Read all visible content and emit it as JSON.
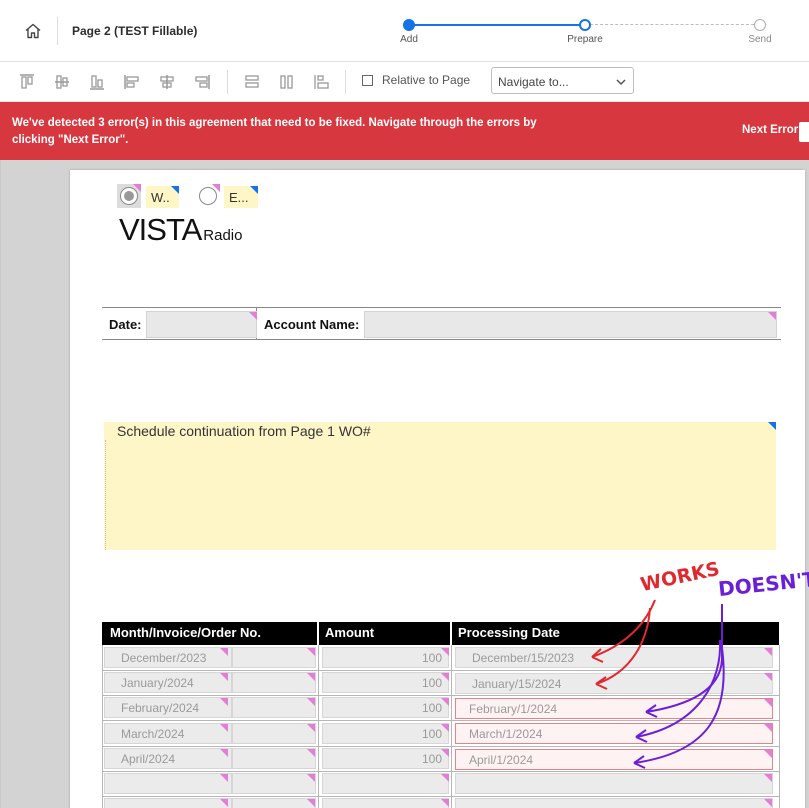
{
  "header": {
    "page_title": "Page 2 (TEST Fillable)",
    "steps": [
      {
        "label": "Add"
      },
      {
        "label": "Prepare"
      },
      {
        "label": "Send"
      }
    ]
  },
  "toolbar": {
    "relative_to_page_label": "Relative to Page",
    "relative_to_page_checked": false,
    "navigate_placeholder": "Navigate to..."
  },
  "error_banner": {
    "message": "We've detected 3 error(s) in this agreement that need to be fixed. Navigate through the errors by clicking \"Next Error\".",
    "next_error_label": "Next Error"
  },
  "document": {
    "radio_options": [
      {
        "label": "W..",
        "selected": true
      },
      {
        "label": "E...",
        "selected": false
      }
    ],
    "logo": {
      "main": "VISTA",
      "sub": "Radio"
    },
    "date_label": "Date:",
    "account_label": "Account Name:",
    "notes_text": "Schedule continuation from Page 1   WO#",
    "table": {
      "headers": [
        "Month/Invoice/Order No.",
        "Amount",
        "Processing Date"
      ],
      "rows": [
        {
          "month": "December/2023",
          "amount": "100",
          "date": "December/15/2023",
          "error": false
        },
        {
          "month": "January/2024",
          "amount": "100",
          "date": "January/15/2024",
          "error": false
        },
        {
          "month": "February/2024",
          "amount": "100",
          "date": "February/1/2024",
          "error": true
        },
        {
          "month": "March/2024",
          "amount": "100",
          "date": "March/1/2024",
          "error": true
        },
        {
          "month": "April/2024",
          "amount": "100",
          "date": "April/1/2024",
          "error": true
        },
        {
          "month": "",
          "amount": "",
          "date": "",
          "error": false
        },
        {
          "month": "",
          "amount": "",
          "date": "",
          "error": false
        }
      ]
    }
  },
  "annotations": {
    "works": "WORKS",
    "doesnt": "DOESN'T",
    "works_color": "#e0282e",
    "doesnt_color": "#6b1fd6"
  },
  "colors": {
    "accent": "#1473e6",
    "error_banner": "#d7373f",
    "field_fill": "#e8e8e8",
    "note_fill": "#fff6c8",
    "marker_pink": "#e27ed6"
  }
}
